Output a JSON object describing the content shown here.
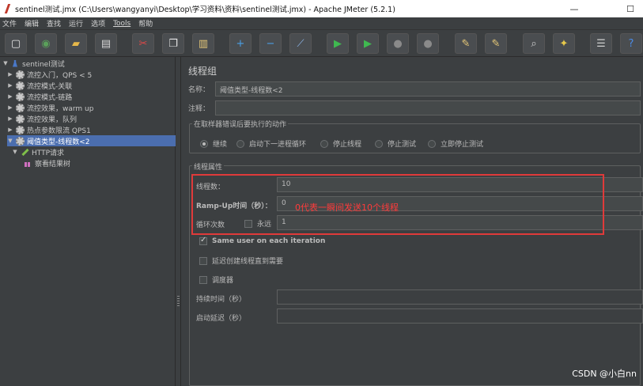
{
  "window": {
    "title": "sentinel测试.jmx (C:\\Users\\wangyanyi\\Desktop\\学习资料\\资料\\sentinel测试.jmx) - Apache JMeter (5.2.1)",
    "minimize": "—",
    "maximize": "☐"
  },
  "menu": [
    "文件",
    "编辑",
    "查找",
    "运行",
    "选项",
    "Tools",
    "帮助"
  ],
  "toolbar": [
    {
      "icon": "new-icon",
      "glyph": "▢",
      "color": "#e6e6e6"
    },
    {
      "icon": "templates-icon",
      "glyph": "◉",
      "color": "#5aa05a"
    },
    {
      "icon": "open-icon",
      "glyph": "▰",
      "color": "#e6b84a"
    },
    {
      "icon": "save-icon",
      "glyph": "▤",
      "color": "#d6d6d6"
    },
    {
      "icon": "cut-icon",
      "glyph": "✂",
      "color": "#e04848"
    },
    {
      "icon": "copy-icon",
      "glyph": "❐",
      "color": "#e6e6e6"
    },
    {
      "icon": "paste-icon",
      "glyph": "▥",
      "color": "#e6c878"
    },
    {
      "icon": "expand-icon",
      "glyph": "+",
      "color": "#4aa0e6"
    },
    {
      "icon": "collapse-icon",
      "glyph": "−",
      "color": "#4aa0e6"
    },
    {
      "icon": "toggle-icon",
      "glyph": "⟋",
      "color": "#8ab4e6"
    },
    {
      "icon": "start-icon",
      "glyph": "▶",
      "color": "#3fb950"
    },
    {
      "icon": "start-no-pause-icon",
      "glyph": "▶",
      "color": "#3fb950"
    },
    {
      "icon": "stop-icon",
      "glyph": "●",
      "color": "#8a8a8a"
    },
    {
      "icon": "shutdown-icon",
      "glyph": "●",
      "color": "#8a8a8a"
    },
    {
      "icon": "clear-icon",
      "glyph": "✎",
      "color": "#e6c878"
    },
    {
      "icon": "clear-all-icon",
      "glyph": "✎",
      "color": "#e6c878"
    },
    {
      "icon": "search-icon",
      "glyph": "⌕",
      "color": "#d0d0d0"
    },
    {
      "icon": "reset-search-icon",
      "glyph": "✦",
      "color": "#e6c84a"
    },
    {
      "icon": "function-helper-icon",
      "glyph": "☰",
      "color": "#d0d0d0"
    },
    {
      "icon": "help-icon",
      "glyph": "?",
      "color": "#4a8ae6"
    }
  ],
  "tree": {
    "root": "sentinel测试",
    "items": [
      "流控入门，QPS < 5",
      "流控模式-关联",
      "流控模式-链路",
      "流控效果，warm up",
      "流控效果，队列",
      "热点参数限流 QPS1",
      "阈值类型-线程数<2"
    ],
    "http": "HTTP请求",
    "listener": "察看结果树"
  },
  "panel": {
    "title": "线程组",
    "name_label": "名称：",
    "name_value": "阈值类型-线程数<2",
    "comment_label": "注释：",
    "comment_value": "",
    "error_group_label": "在取样器错误后要执行的动作",
    "error_options": [
      "继续",
      "启动下一进程循环",
      "停止线程",
      "停止测试",
      "立即停止测试"
    ],
    "error_selected": 0,
    "thread_group_label": "线程属性",
    "threads_label": "线程数：",
    "threads_value": "10",
    "rampup_label": "Ramp-Up时间（秒）：",
    "rampup_value": "0",
    "loop_label": "循环次数",
    "forever_label": "永远",
    "forever_checked": false,
    "loop_value": "1",
    "same_user_label": "Same user on each iteration",
    "same_user_checked": true,
    "delay_label": "延迟创建线程直到需要",
    "delay_checked": false,
    "scheduler_label": "调度器",
    "scheduler_checked": false,
    "duration_label": "持续时间（秒）",
    "duration_value": "",
    "startup_label": "启动延迟（秒）",
    "startup_value": ""
  },
  "annotation": "0代表一瞬间发送10个线程",
  "watermark": "CSDN @小白nn"
}
